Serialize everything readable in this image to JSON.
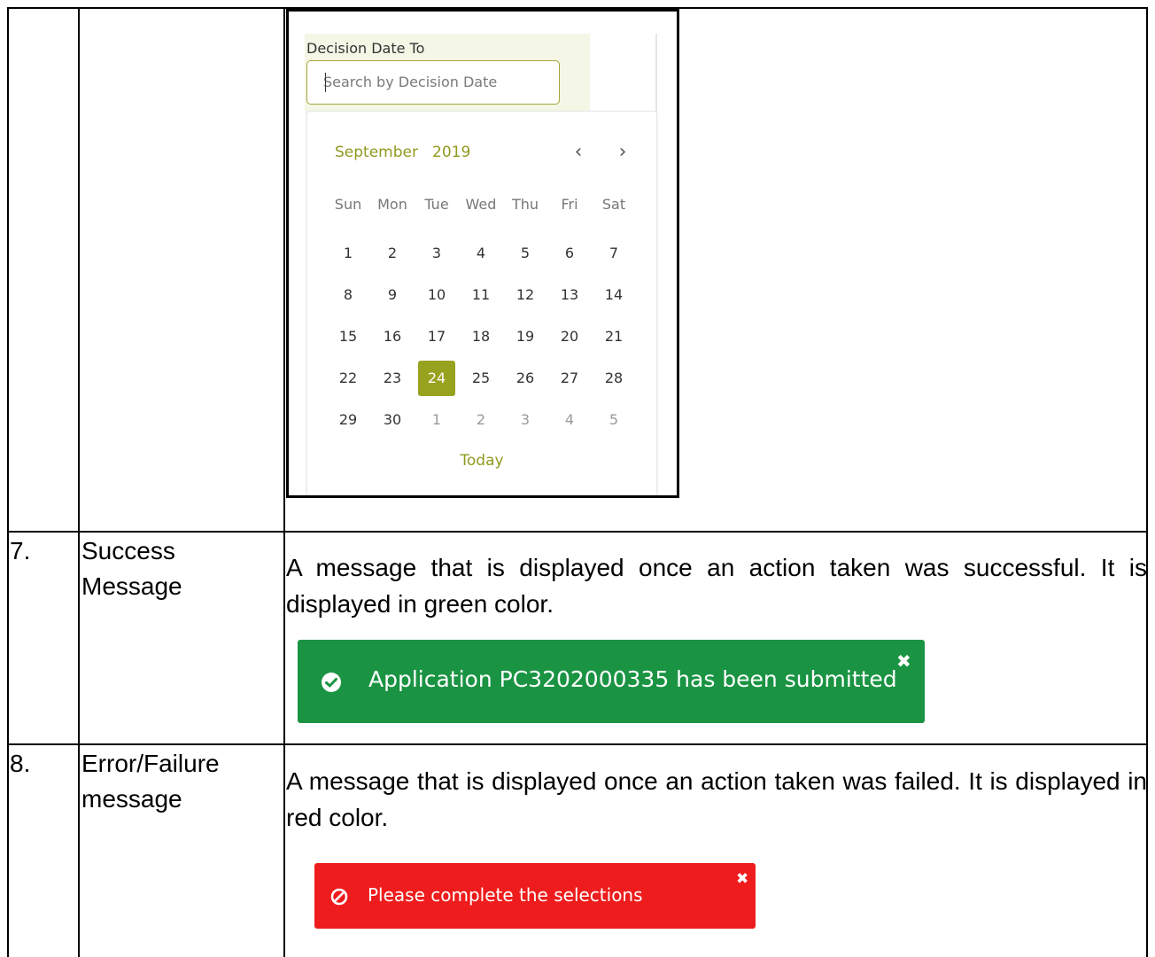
{
  "rows": [
    {
      "number": "7.",
      "title_line1": "Success",
      "title_line2": "Message",
      "description": "A message that is displayed once an action taken was successful. It is displayed in green color."
    },
    {
      "number": "8.",
      "title_line1": "Error/Failure",
      "title_line2": "message",
      "description": "A message that is displayed once an action taken was failed. It is displayed in red color."
    }
  ],
  "datepicker": {
    "field_label": "Decision Date To",
    "placeholder": "Search by Decision Date",
    "month": "September",
    "year": "2019",
    "prev_icon": "‹",
    "next_icon": "›",
    "weekdays": [
      "Sun",
      "Mon",
      "Tue",
      "Wed",
      "Thu",
      "Fri",
      "Sat"
    ],
    "weeks": [
      [
        "1",
        "2",
        "3",
        "4",
        "5",
        "6",
        "7"
      ],
      [
        "8",
        "9",
        "10",
        "11",
        "12",
        "13",
        "14"
      ],
      [
        "15",
        "16",
        "17",
        "18",
        "19",
        "20",
        "21"
      ],
      [
        "22",
        "23",
        "24",
        "25",
        "26",
        "27",
        "28"
      ],
      [
        "29",
        "30",
        "1",
        "2",
        "3",
        "4",
        "5"
      ]
    ],
    "selected_day": "24",
    "today_label": "Today",
    "accent_color": "#97a21f"
  },
  "success_alert": {
    "message": "Application PC3202000335 has been submitted",
    "icon": "check-circle-icon",
    "close": "✖",
    "color": "#1a9443"
  },
  "error_alert": {
    "message": "Please complete the selections",
    "icon": "ban-icon",
    "close": "✖",
    "color": "#ee1c1c"
  }
}
